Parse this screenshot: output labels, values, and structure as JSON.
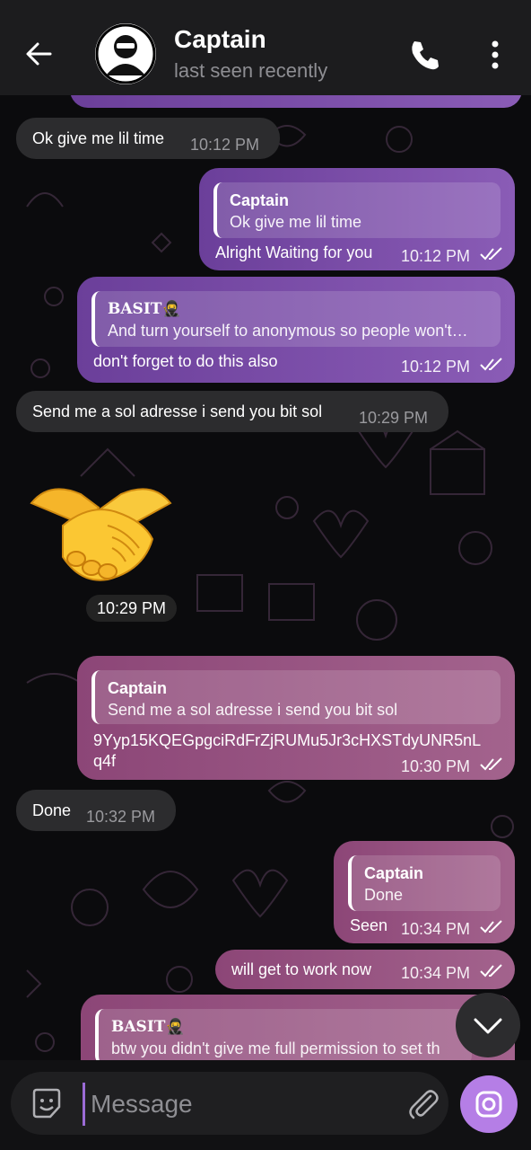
{
  "header": {
    "title": "Captain",
    "subtitle": "last seen recently",
    "icons": [
      "back-arrow-icon",
      "phone-icon",
      "more-vertical-icon"
    ]
  },
  "messages": [
    {
      "id": "m1",
      "dir": "in",
      "text": "Ok give me lil time",
      "time": "10:12 PM"
    },
    {
      "id": "m2",
      "dir": "out",
      "reply_name": "Captain",
      "reply_text": "Ok give me lil time",
      "text": "Alright Waiting for you",
      "time": "10:12 PM"
    },
    {
      "id": "m3",
      "dir": "out",
      "reply_name": "BASIT🥷",
      "reply_text": "And turn yourself to anonymous so people won't…",
      "text": "don't forget to do this also",
      "time": "10:12 PM"
    },
    {
      "id": "m4",
      "dir": "in",
      "text": "Send me a sol adresse i send you bit sol",
      "time": "10:29 PM"
    },
    {
      "id": "m5",
      "dir": "in",
      "sticker": "handshake",
      "time": "10:29 PM"
    },
    {
      "id": "m6",
      "dir": "out",
      "reply_name": "Captain",
      "reply_text": "Send me a sol adresse i send you bit sol",
      "text_line1": "9Yyp15KQEGpgciRdFrZjRUMu5Jr3cHXSTdyUNR5nL",
      "text_line2": "q4f",
      "time": "10:30 PM"
    },
    {
      "id": "m7",
      "dir": "in",
      "text": "Done",
      "time": "10:32 PM"
    },
    {
      "id": "m8",
      "dir": "out",
      "reply_name": "Captain",
      "reply_text": "Done",
      "text": "Seen",
      "time": "10:34 PM"
    },
    {
      "id": "m9",
      "dir": "out",
      "text": "will get to work now",
      "time": "10:34 PM"
    },
    {
      "id": "m10",
      "dir": "out",
      "reply_name": "BASIT🥷",
      "reply_text": "btw you didn't give me full permission to set th"
    }
  ],
  "input": {
    "placeholder": "Message"
  },
  "colors": {
    "purple": "#7d4fb0",
    "mauve": "#9a567f",
    "incoming": "#2c2c2e",
    "accent": "#b57ee6"
  }
}
